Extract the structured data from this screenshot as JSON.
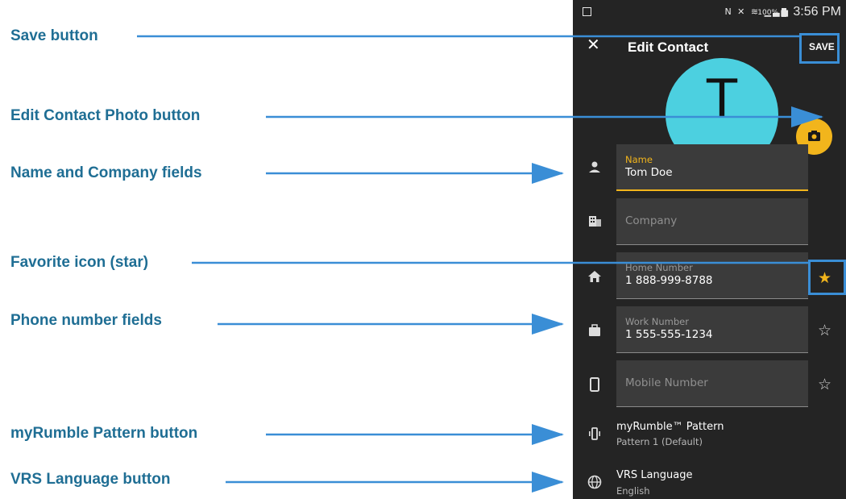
{
  "annotations": {
    "save": "Save button",
    "photo": "Edit Contact Photo button",
    "name_company": "Name and Company fields",
    "favorite": "Favorite icon (star)",
    "phone_fields": "Phone number fields",
    "rumble": "myRumble Pattern button",
    "vrs": "VRS Language button"
  },
  "status_bar": {
    "battery_percent": "100%",
    "time": "3:56 PM"
  },
  "app_bar": {
    "close_icon": "close-icon",
    "title": "Edit Contact",
    "save_label": "SAVE"
  },
  "avatar": {
    "initial": "T",
    "color": "#4cd0e0"
  },
  "camera_button": {
    "icon": "camera-icon",
    "color": "#f2b51c"
  },
  "fields": {
    "name": {
      "label": "Name",
      "value": "Tom Doe",
      "icon": "person-icon"
    },
    "company": {
      "placeholder": "Company",
      "icon": "building-icon"
    },
    "home": {
      "label": "Home Number",
      "value": "1 888-999-8788",
      "icon": "home-icon",
      "favorite": true
    },
    "work": {
      "label": "Work Number",
      "value": "1 555-555-1234",
      "icon": "briefcase-icon",
      "favorite": false
    },
    "mobile": {
      "placeholder": "Mobile Number",
      "icon": "mobile-phone-icon",
      "favorite": false
    }
  },
  "star_glyphs": {
    "filled": "★",
    "outline": "☆"
  },
  "rumble": {
    "title": "myRumble™ Pattern",
    "subtitle": "Pattern 1 (Default)",
    "icon": "vibrate-icon"
  },
  "vrs_language": {
    "title": "VRS Language",
    "subtitle": "English",
    "icon": "globe-icon"
  },
  "colors": {
    "accent": "#f2b51c",
    "annotation_text": "#1f6e94",
    "arrow": "#3a8ed6",
    "background": "#242424"
  }
}
